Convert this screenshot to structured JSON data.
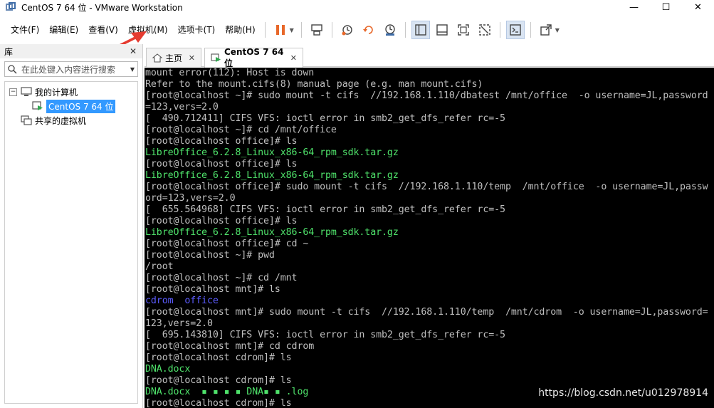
{
  "window": {
    "title": "CentOS 7 64 位 - VMware Workstation",
    "minimize_glyph": "—",
    "maximize_glyph": "☐",
    "close_glyph": "✕"
  },
  "menu": {
    "items": [
      {
        "label": "文件(F)"
      },
      {
        "label": "编辑(E)"
      },
      {
        "label": "查看(V)"
      },
      {
        "label": "虚拟机(M)"
      },
      {
        "label": "选项卡(T)"
      },
      {
        "label": "帮助(H)"
      }
    ]
  },
  "toolbar": {
    "icons": [
      "pause-icon",
      "send-ctrl-alt-del-icon",
      "snapshot-icon",
      "revert-snapshot-icon",
      "snapshot-manager-icon",
      "sidebar-toggle-icon",
      "thumbnail-bar-icon",
      "fullscreen-icon",
      "unity-icon",
      "console-view-icon",
      "stretch-icon"
    ],
    "accent": "#e8682a"
  },
  "library": {
    "title": "库",
    "search_placeholder": "在此处键入内容进行搜索",
    "tree": {
      "root_label": "我的计算机",
      "root_toggle": "⊟",
      "vm_label": "CentOS 7 64 位",
      "shared_label": "共享的虚拟机"
    }
  },
  "tabs": {
    "home_label": "主页",
    "vm_label": "CentOS 7 64 位"
  },
  "console": {
    "lines": [
      {
        "text": "mount error(112): Host is down",
        "color": "default"
      },
      {
        "text": "Refer to the mount.cifs(8) manual page (e.g. man mount.cifs)",
        "color": "default"
      },
      {
        "text": "[root@localhost ~]# sudo mount -t cifs  //192.168.1.110/dbatest /mnt/office  -o username=JL,password",
        "color": "default"
      },
      {
        "text": "=123,vers=2.0",
        "color": "default"
      },
      {
        "text": "[  490.712411] CIFS VFS: ioctl error in smb2_get_dfs_refer rc=-5",
        "color": "default"
      },
      {
        "text": "[root@localhost ~]# cd /mnt/office",
        "color": "default"
      },
      {
        "text": "[root@localhost office]# ls",
        "color": "default"
      },
      {
        "text": "LibreOffice_6.2.8_Linux_x86-64_rpm_sdk.tar.gz",
        "color": "green"
      },
      {
        "text": "[root@localhost office]# ls",
        "color": "default"
      },
      {
        "text": "LibreOffice_6.2.8_Linux_x86-64_rpm_sdk.tar.gz",
        "color": "green"
      },
      {
        "text": "[root@localhost office]# sudo mount -t cifs  //192.168.1.110/temp  /mnt/office  -o username=JL,passw",
        "color": "default"
      },
      {
        "text": "ord=123,vers=2.0",
        "color": "default"
      },
      {
        "text": "[  655.564968] CIFS VFS: ioctl error in smb2_get_dfs_refer rc=-5",
        "color": "default"
      },
      {
        "text": "[root@localhost office]# ls",
        "color": "default"
      },
      {
        "text": "LibreOffice_6.2.8_Linux_x86-64_rpm_sdk.tar.gz",
        "color": "green"
      },
      {
        "text": "[root@localhost office]# cd ~",
        "color": "default"
      },
      {
        "text": "[root@localhost ~]# pwd",
        "color": "default"
      },
      {
        "text": "/root",
        "color": "default"
      },
      {
        "text": "[root@localhost ~]# cd /mnt",
        "color": "default"
      },
      {
        "text": "[root@localhost mnt]# ls",
        "color": "default"
      },
      {
        "text": "cdrom  office",
        "color": "blue"
      },
      {
        "text": "[root@localhost mnt]# sudo mount -t cifs  //192.168.1.110/temp  /mnt/cdrom  -o username=JL,password=",
        "color": "default"
      },
      {
        "text": "123,vers=2.0",
        "color": "default"
      },
      {
        "text": "[  695.143810] CIFS VFS: ioctl error in smb2_get_dfs_refer rc=-5",
        "color": "default"
      },
      {
        "text": "[root@localhost mnt]# cd cdrom",
        "color": "default"
      },
      {
        "text": "[root@localhost cdrom]# ls",
        "color": "default"
      },
      {
        "text": "DNA.docx",
        "color": "green"
      },
      {
        "text": "[root@localhost cdrom]# ls",
        "color": "default"
      },
      {
        "text": "DNA.docx  ▪ ▪ ▪ ▪ DNA▪ ▪ .log",
        "color": "green"
      },
      {
        "text": "[root@localhost cdrom]# ls",
        "color": "default"
      }
    ],
    "colors": {
      "default": "#bfbfbf",
      "green": "#4fe36b",
      "blue": "#5c5cff"
    }
  },
  "watermark": "https://blog.csdn.net/u012978914"
}
